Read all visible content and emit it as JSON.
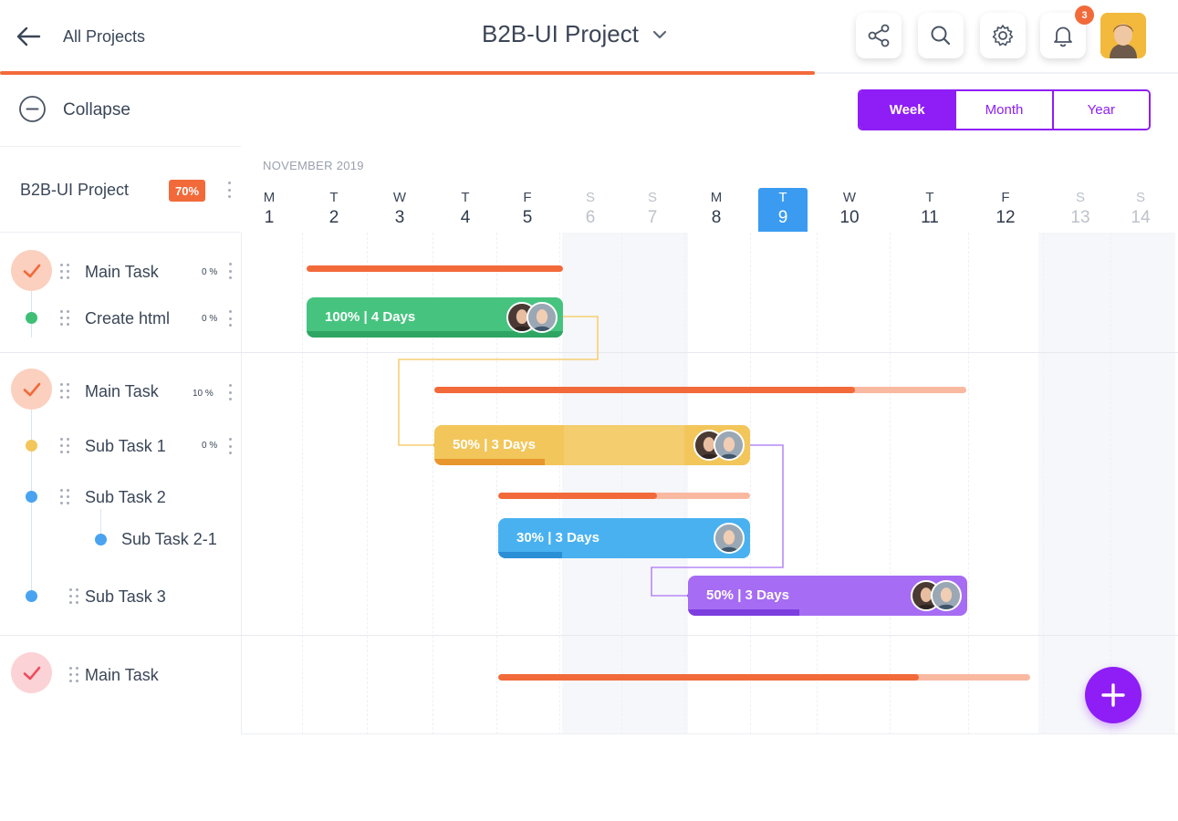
{
  "header": {
    "back_label": "All Projects",
    "project_title": "B2B-UI Project",
    "notification_count": "3"
  },
  "toolbar": {
    "collapse_label": "Collapse",
    "views": [
      "Week",
      "Month",
      "Year"
    ],
    "active_view": "Week"
  },
  "project": {
    "name": "B2B-UI Project",
    "progress_badge": "70%"
  },
  "timeline": {
    "month_label": "NOVEMBER 2019",
    "days": [
      {
        "letter": "M",
        "num": "1"
      },
      {
        "letter": "T",
        "num": "2"
      },
      {
        "letter": "W",
        "num": "3"
      },
      {
        "letter": "T",
        "num": "4"
      },
      {
        "letter": "F",
        "num": "5"
      },
      {
        "letter": "S",
        "num": "6"
      },
      {
        "letter": "S",
        "num": "7"
      },
      {
        "letter": "M",
        "num": "8"
      },
      {
        "letter": "T",
        "num": "9"
      },
      {
        "letter": "W",
        "num": "10"
      },
      {
        "letter": "T",
        "num": "11"
      },
      {
        "letter": "F",
        "num": "12"
      },
      {
        "letter": "S",
        "num": "13"
      },
      {
        "letter": "S",
        "num": "14"
      }
    ],
    "today": "9"
  },
  "tasks": {
    "t1": {
      "label": "Main Task",
      "pct": "0 %"
    },
    "t1a": {
      "label": "Create html",
      "pct": "0 %"
    },
    "t2": {
      "label": "Main Task",
      "pct": "10 %"
    },
    "t2a": {
      "label": "Sub Task 1",
      "pct": "0 %"
    },
    "t2b": {
      "label": "Sub Task 2"
    },
    "t2b1": {
      "label": "Sub Task 2-1"
    },
    "t2c": {
      "label": "Sub Task 3"
    },
    "t3": {
      "label": "Main Task"
    }
  },
  "bars": {
    "create_html": {
      "label": "100% | 4 Days",
      "progress": 1.0
    },
    "sub1": {
      "label": "50% | 3 Days",
      "progress": 0.5
    },
    "sub21": {
      "label": "30% | 3 Days",
      "progress": 0.3
    },
    "sub3": {
      "label": "50% | 3 Days",
      "progress": 0.5
    },
    "main2_progress": 0.79,
    "sub2_progress": 0.63,
    "main3_progress": 0.79
  },
  "colors": {
    "accent": "#8e1ef5",
    "orange": "#f26a3a",
    "green": "#3fbf76",
    "yellow": "#f2c65a",
    "blue": "#49b1f0",
    "purple": "#a66cf3",
    "today": "#3a9bf0"
  }
}
